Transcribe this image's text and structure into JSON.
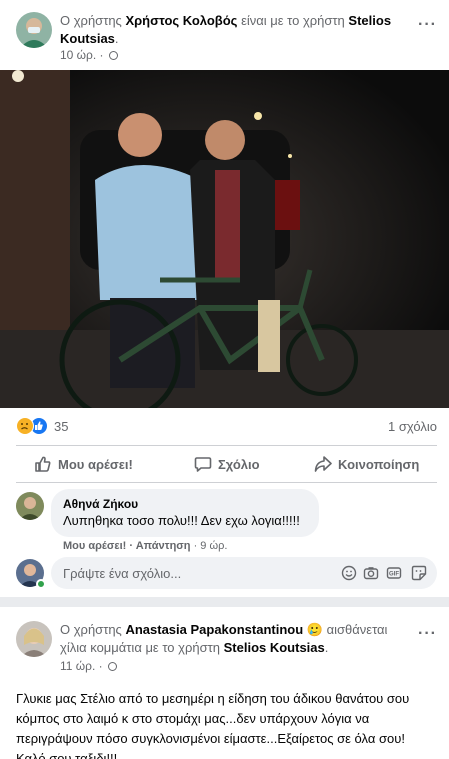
{
  "post1": {
    "header_prefix": "Ο χρήστης",
    "author": "Χρήστος Κολοβός",
    "header_middle": "είναι με το χρήστη",
    "tagged": "Stelios Koutsias",
    "header_suffix": ".",
    "time": "10 ώρ. ·",
    "privacy_icon": "globe-icon",
    "more_label": "···",
    "reaction_icons": [
      "sad-icon",
      "like-icon"
    ],
    "reaction_count": "35",
    "comment_count": "1 σχόλιο",
    "actions": {
      "like": "Μου αρέσει!",
      "comment": "Σχόλιο",
      "share": "Κοινοποίηση"
    },
    "comment": {
      "author": "Αθηνά Ζήκου",
      "text": "Λυπηθηκα τοσο πολυ!!! Δεν εχω λογια!!!!!",
      "like": "Μου αρέσει!",
      "sep": " · ",
      "reply": "Απάντηση",
      "time": " · 9 ώρ."
    },
    "composer": {
      "placeholder": "Γράψτε ένα σχόλιο..."
    }
  },
  "post2": {
    "header_prefix": "Ο χρήστης",
    "author": "Anastasia Papakonstantinou",
    "feeling_emoji": "🥲",
    "header_middle": "αισθάνεται χίλια κομμάτια με το χρήστη",
    "tagged": "Stelios Koutsias",
    "header_suffix": ".",
    "time": "11 ώρ. ·",
    "more_label": "···",
    "body": "Γλυκιε μας Στέλιο από το μεσημέρι η είδηση του άδικου θανάτου σου κόμπος στο λαιμό κ στο στομάχι μας...δεν υπάρχουν λόγια να περιγράψουν πόσο συγκλονισμένοι είμαστε...Εξαίρετος σε όλα σου! Καλό σου ταξιδι!!!"
  },
  "colors": {
    "accent": "#1877f2",
    "secondary_text": "#65676b",
    "bubble": "#f0f2f5",
    "sad": "#f7b125",
    "online": "#31a24c"
  }
}
